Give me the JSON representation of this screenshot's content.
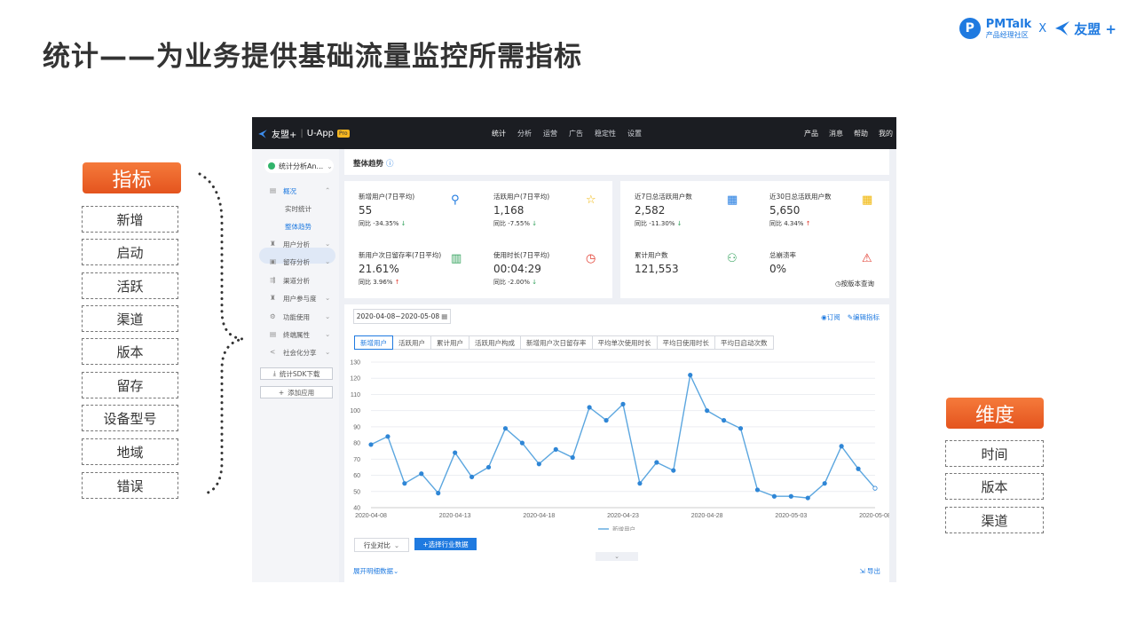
{
  "slide": {
    "title": "统计——为业务提供基础流量监控所需指标",
    "brand": {
      "pm_name": "PMTalk",
      "pm_sub": "产品经理社区",
      "separator": "X",
      "umeng": "友盟 +"
    }
  },
  "metrics": {
    "badge": "指标",
    "items": [
      "新增",
      "启动",
      "活跃",
      "渠道",
      "版本",
      "留存",
      "设备型号",
      "地域",
      "错误"
    ]
  },
  "dimensions": {
    "badge": "维度",
    "items": [
      "时间",
      "版本",
      "渠道"
    ]
  },
  "app": {
    "topbar": {
      "logo": "友盟+",
      "product": "U-App",
      "pro": "Pro",
      "nav": [
        "统计",
        "分析",
        "运营",
        "广告",
        "稳定性",
        "设置"
      ],
      "active_nav": "统计",
      "right": [
        "产品",
        "消息",
        "帮助",
        "我的"
      ]
    },
    "sidebar": {
      "app_name": "统计分析An...",
      "overview": "概况",
      "overview_sub": [
        "实时统计",
        "整体趋势"
      ],
      "items": [
        "用户分析",
        "留存分析",
        "渠道分析",
        "用户参与度",
        "功能使用",
        "终端属性",
        "社会化分享"
      ],
      "sdk_button": "统计SDK下载",
      "add_button": "添加应用"
    },
    "breadcrumb": "整体趋势",
    "stats_left": [
      {
        "label": "新增用户(7日平均)",
        "value": "55",
        "cmp": "同比  -34.35%",
        "dir": "down"
      },
      {
        "label": "活跃用户(7日平均)",
        "value": "1,168",
        "cmp": "同比  -7.55%",
        "dir": "down"
      },
      {
        "label": "新用户次日留存率(7日平均)",
        "value": "21.61%",
        "cmp": "同比  3.96%",
        "dir": "up"
      },
      {
        "label": "使用时长(7日平均)",
        "value": "00:04:29",
        "cmp": "同比  -2.00%",
        "dir": "down"
      }
    ],
    "stats_right": [
      {
        "label": "近7日总活跃用户数",
        "value": "2,582",
        "cmp": "同比  -11.30%",
        "dir": "down"
      },
      {
        "label": "近30日总活跃用户数",
        "value": "5,650",
        "cmp": "同比  4.34%",
        "dir": "up"
      },
      {
        "label": "累计用户数",
        "value": "121,553",
        "cmp": "",
        "dir": ""
      },
      {
        "label": "总崩溃率",
        "value": "0%",
        "cmp": "",
        "dir": ""
      }
    ],
    "version_link": "按版本查询",
    "date_range": "2020-04-08~2020-05-08",
    "subscribe": "订阅",
    "edit_metric": "编辑指标",
    "tabs": [
      "新增用户",
      "活跃用户",
      "累计用户",
      "活跃用户构成",
      "新增用户次日留存率",
      "平均单次使用时长",
      "平均日使用时长",
      "平均日启动次数"
    ],
    "active_tab": "新增用户",
    "industry": "行业对比",
    "select_industry": "+选择行业数据",
    "expand": "展开明细数据",
    "export": "导出",
    "colors": {
      "accent": "#1f7ae0",
      "line": "#5ba6df",
      "up": "#e23b2e",
      "down": "#31a15b"
    }
  },
  "chart_data": {
    "type": "line",
    "x": [
      "2020-04-08",
      "2020-04-09",
      "2020-04-10",
      "2020-04-11",
      "2020-04-12",
      "2020-04-13",
      "2020-04-14",
      "2020-04-15",
      "2020-04-16",
      "2020-04-17",
      "2020-04-18",
      "2020-04-19",
      "2020-04-20",
      "2020-04-21",
      "2020-04-22",
      "2020-04-23",
      "2020-04-24",
      "2020-04-25",
      "2020-04-26",
      "2020-04-27",
      "2020-04-28",
      "2020-04-29",
      "2020-04-30",
      "2020-05-01",
      "2020-05-02",
      "2020-05-03",
      "2020-05-04",
      "2020-05-05",
      "2020-05-06",
      "2020-05-07",
      "2020-05-08"
    ],
    "xticks": [
      "2020-04-08",
      "2020-04-13",
      "2020-04-18",
      "2020-04-23",
      "2020-04-28",
      "2020-05-03",
      "2020-05-08"
    ],
    "series": [
      {
        "name": "新增用户",
        "values": [
          79,
          84,
          55,
          61,
          49,
          74,
          59,
          65,
          89,
          80,
          67,
          76,
          71,
          102,
          94,
          104,
          55,
          68,
          63,
          122,
          100,
          94,
          89,
          51,
          47,
          47,
          46,
          55,
          78,
          64,
          52
        ]
      }
    ],
    "ylim": [
      40,
      130
    ],
    "yticks": [
      40,
      50,
      60,
      70,
      80,
      90,
      100,
      110,
      120,
      130
    ],
    "legend": "bottom-center",
    "grid": true
  }
}
